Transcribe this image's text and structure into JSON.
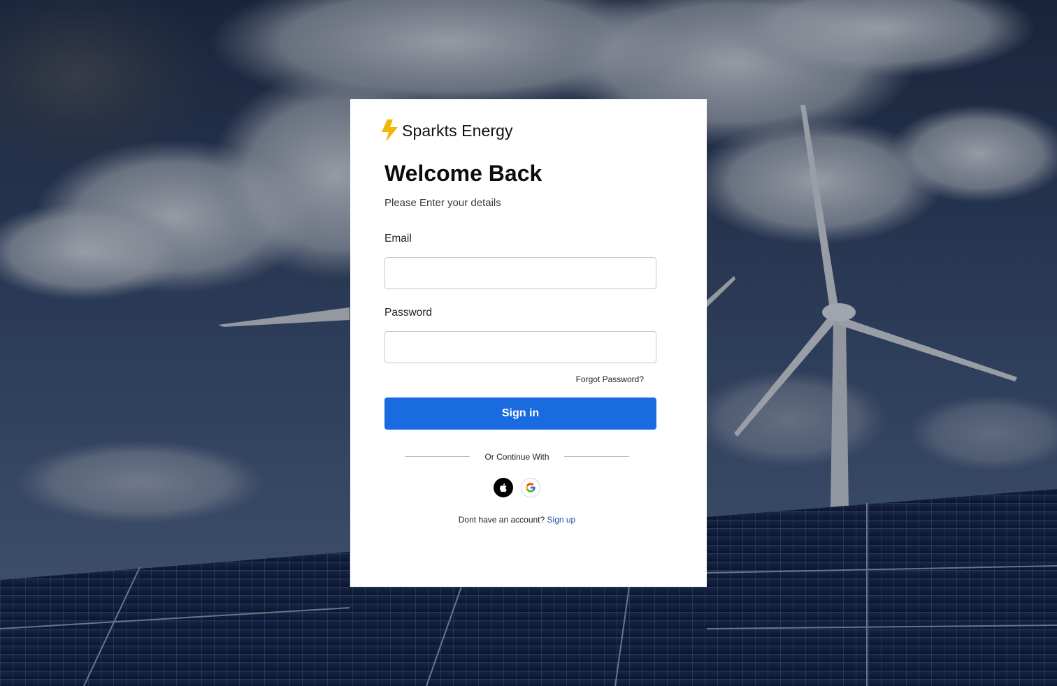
{
  "brand": {
    "name": "Sparkts Energy",
    "accent_color": "#f2b705"
  },
  "heading": {
    "title": "Welcome Back",
    "subtitle": "Please Enter your details"
  },
  "form": {
    "email_label": "Email",
    "email_value": "",
    "password_label": "Password",
    "password_value": "",
    "forgot_password": "Forgot Password?",
    "sign_in_label": "Sign in",
    "sign_in_color": "#1a6be0"
  },
  "social": {
    "divider_text": "Or Continue With",
    "providers": [
      {
        "name": "Apple",
        "icon": "apple-icon"
      },
      {
        "name": "Google",
        "icon": "google-icon"
      }
    ]
  },
  "signup": {
    "prompt": "Dont have an account?",
    "link_text": "Sign up"
  },
  "background": {
    "description_icon": "wind-turbine-solar-panel-scene"
  }
}
